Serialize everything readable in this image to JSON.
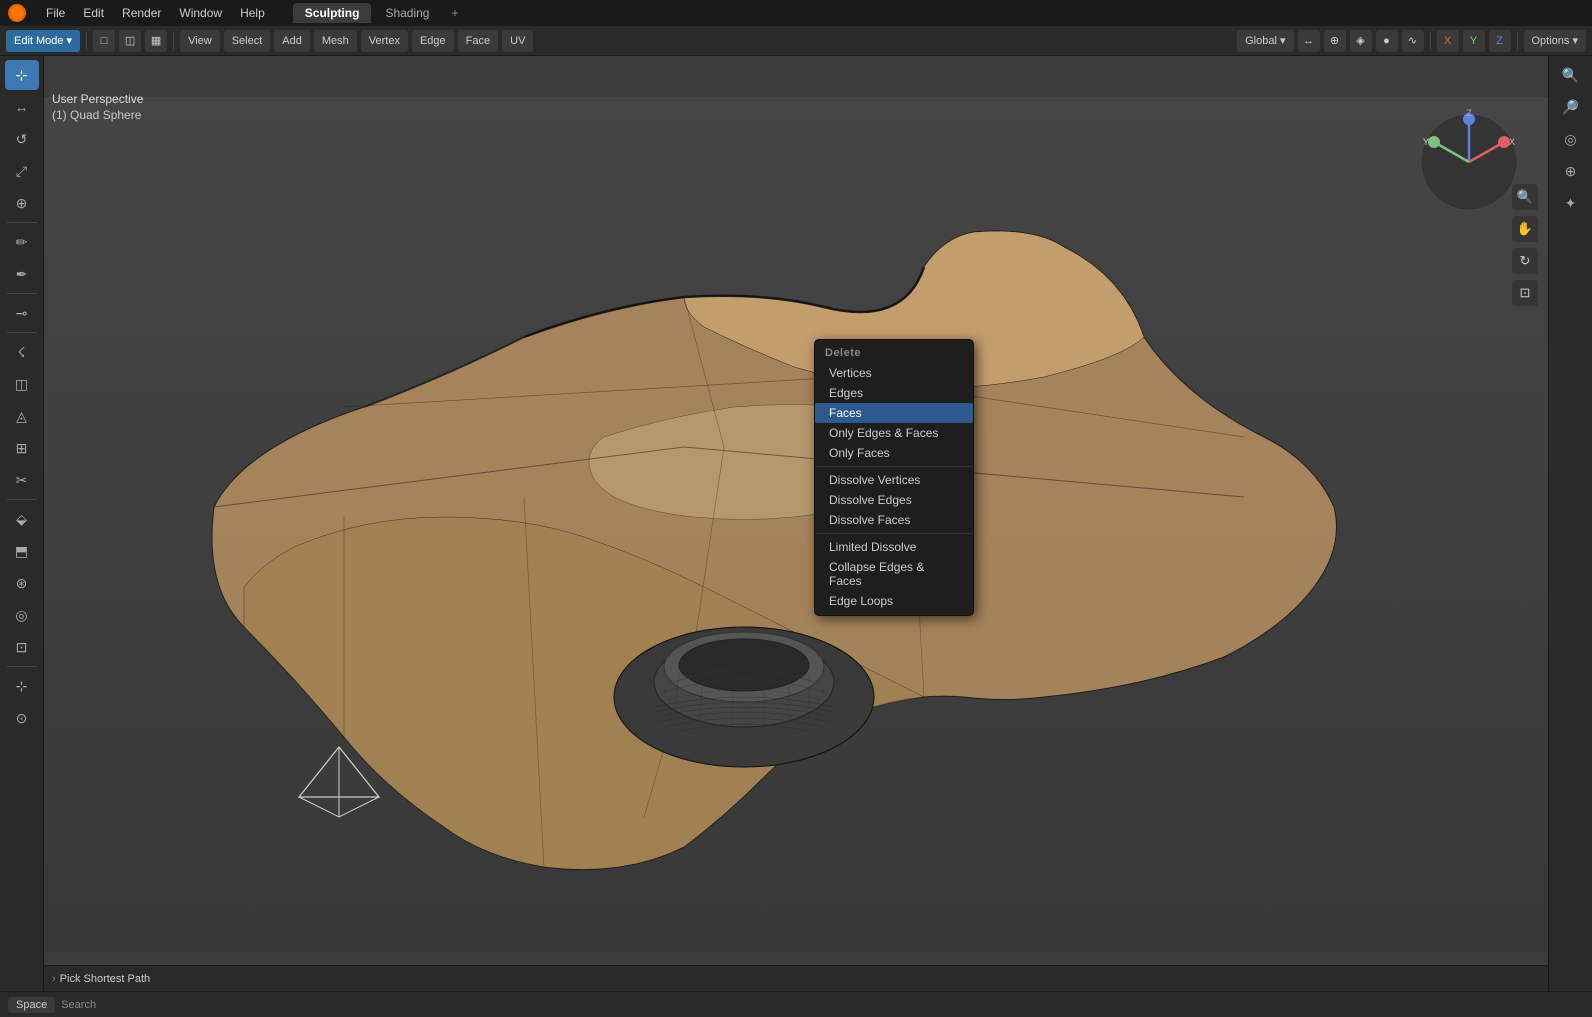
{
  "titlebar": {
    "logo": "blender-logo",
    "menus": [
      "File",
      "Edit",
      "Render",
      "Window",
      "Help"
    ],
    "tabs": [
      "Sculpting",
      "Shading"
    ],
    "active_tab": "Sculpting",
    "add_tab": "+"
  },
  "top_toolbar": {
    "mode_btn": "Edit Mode",
    "mode_icon": "▾",
    "icons": [
      "□",
      "◫",
      "▦"
    ],
    "view_btn": "View",
    "select_btn": "Select",
    "add_btn": "Add",
    "mesh_btn": "Mesh",
    "vertex_btn": "Vertex",
    "edge_btn": "Edge",
    "face_btn": "Face",
    "uv_btn": "UV",
    "right_items": [
      "Global",
      "↔",
      "⊕",
      "◈",
      "●",
      "∿",
      "X",
      "Y",
      "Z",
      "Options"
    ]
  },
  "header_info": {
    "icon": "✦",
    "label1": "◈",
    "label2": "□",
    "label3": "□"
  },
  "viewport": {
    "label_perspective": "User Perspective",
    "label_object": "(1) Quad Sphere"
  },
  "context_menu": {
    "title": "Delete",
    "items": [
      {
        "label": "Vertices",
        "selected": false
      },
      {
        "label": "Edges",
        "selected": false
      },
      {
        "label": "Faces",
        "selected": true
      },
      {
        "label": "Only Edges & Faces",
        "selected": false
      },
      {
        "label": "Only Faces",
        "selected": false
      },
      {
        "sep": true
      },
      {
        "label": "Dissolve Vertices",
        "selected": false
      },
      {
        "label": "Dissolve Edges",
        "selected": false
      },
      {
        "label": "Dissolve Faces",
        "selected": false
      },
      {
        "sep": true
      },
      {
        "label": "Limited Dissolve",
        "selected": false
      },
      {
        "label": "Collapse Edges & Faces",
        "selected": false
      },
      {
        "label": "Edge Loops",
        "selected": false
      }
    ]
  },
  "left_sidebar": {
    "icons": [
      {
        "symbol": "◈",
        "name": "cursor-tool",
        "active": true
      },
      {
        "symbol": "↔",
        "name": "move-tool"
      },
      {
        "symbol": "↺",
        "name": "rotate-tool"
      },
      {
        "symbol": "⤢",
        "name": "scale-tool"
      },
      {
        "symbol": "⊕",
        "name": "transform-tool"
      },
      "sep",
      {
        "symbol": "⬡",
        "name": "annotate-tool"
      },
      {
        "symbol": "✏",
        "name": "draw-tool"
      },
      "sep",
      {
        "symbol": "◫",
        "name": "measure-tool"
      },
      "sep",
      {
        "symbol": "☇",
        "name": "extrude-tool"
      },
      {
        "symbol": "⬜",
        "name": "inset-tool"
      },
      {
        "symbol": "✦",
        "name": "bevel-tool"
      },
      {
        "symbol": "⊞",
        "name": "loop-cut-tool"
      },
      {
        "symbol": "✂",
        "name": "knife-tool"
      },
      "sep",
      {
        "symbol": "⬙",
        "name": "poly-build-tool"
      },
      {
        "symbol": "⬒",
        "name": "spin-tool"
      },
      {
        "symbol": "⊛",
        "name": "smooth-tool"
      },
      {
        "symbol": "◎",
        "name": "randomize-tool"
      },
      {
        "symbol": "⊡",
        "name": "edge-slide-tool"
      },
      "sep",
      {
        "symbol": "⊹",
        "name": "shrink-fatten-tool"
      },
      {
        "symbol": "⊙",
        "name": "shear-tool"
      }
    ]
  },
  "right_sidebar": {
    "icons": [
      {
        "symbol": "🔍",
        "name": "zoom-in-icon"
      },
      {
        "symbol": "🔎",
        "name": "zoom-out-icon"
      },
      {
        "symbol": "◎",
        "name": "zoom-fit-icon"
      },
      {
        "symbol": "⊕",
        "name": "camera-icon"
      },
      {
        "symbol": "✦",
        "name": "render-icon"
      }
    ]
  },
  "bottom_info": {
    "pick_path_label": "Pick Shortest Path"
  },
  "bottom_bar": {
    "space_label": "Space",
    "search_label": "Search"
  },
  "colors": {
    "accent": "#2d6b9e",
    "selected_menu": "#2d5a8e",
    "bg_dark": "#1a1a1a",
    "bg_mid": "#2a2a2a",
    "bg_viewport": "#3c3c3c"
  }
}
